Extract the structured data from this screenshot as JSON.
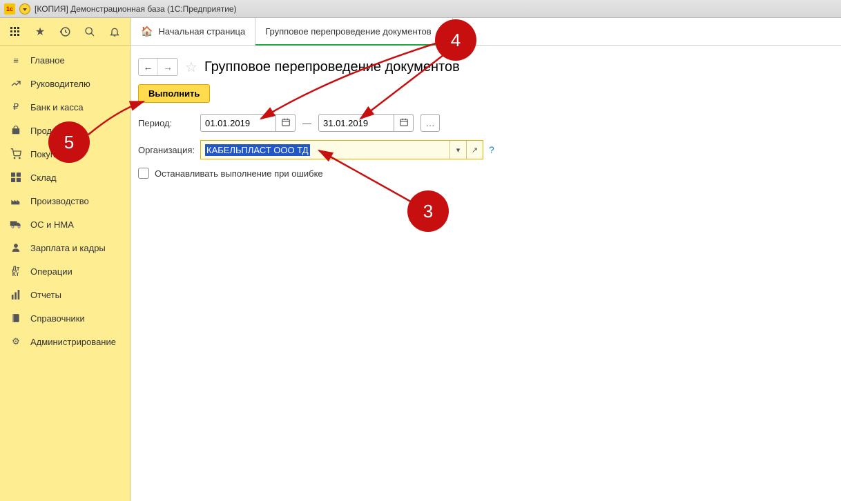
{
  "titlebar": {
    "text": "[КОПИЯ] Демонстрационная база  (1С:Предприятие)"
  },
  "sidebar": {
    "items": [
      {
        "icon": "menu",
        "label": "Главное"
      },
      {
        "icon": "chart",
        "label": "Руководителю"
      },
      {
        "icon": "ruble",
        "label": "Банк и касса"
      },
      {
        "icon": "bag",
        "label": "Продажи"
      },
      {
        "icon": "cart",
        "label": "Покупки"
      },
      {
        "icon": "grid",
        "label": "Склад"
      },
      {
        "icon": "factory",
        "label": "Производство"
      },
      {
        "icon": "truck",
        "label": "ОС и НМА"
      },
      {
        "icon": "person",
        "label": "Зарплата и кадры"
      },
      {
        "icon": "dtkt",
        "label": "Операции"
      },
      {
        "icon": "bars",
        "label": "Отчеты"
      },
      {
        "icon": "book",
        "label": "Справочники"
      },
      {
        "icon": "gear",
        "label": "Администрирование"
      }
    ]
  },
  "tabs": {
    "home": "Начальная страница",
    "active": "Групповое перепроведение документов"
  },
  "page": {
    "title": "Групповое перепроведение документов",
    "execute": "Выполнить",
    "period_label": "Период:",
    "date_from": "01.01.2019",
    "date_to": "31.01.2019",
    "dash": "—",
    "org_label": "Организация:",
    "org_value": "КАБЕЛЬПЛАСТ ООО ТД",
    "stop_on_error": "Останавливать выполнение при ошибке",
    "help": "?"
  },
  "annotations": {
    "b3": "3",
    "b4": "4",
    "b5": "5"
  }
}
